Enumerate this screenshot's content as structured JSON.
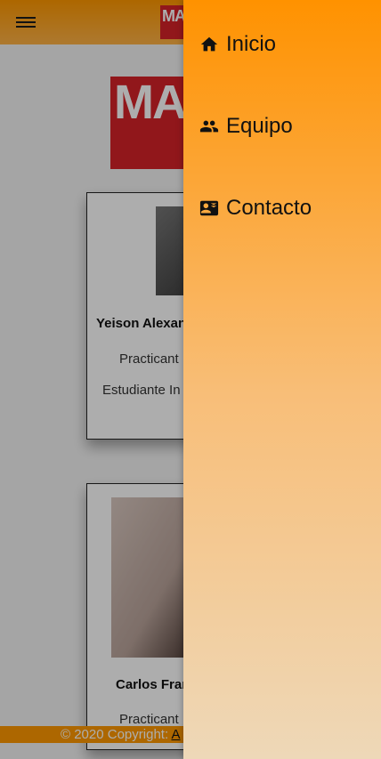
{
  "header": {
    "menu_icon": "hamburger-menu-icon",
    "logo_text": "MA TE"
  },
  "hero": {
    "logo_text": "MA TE"
  },
  "cards": [
    {
      "name": "Yeison Alexan",
      "role": "Practicant",
      "description": "Estudiante In U"
    },
    {
      "name": "Carlos Fran",
      "role": "Practicant"
    }
  ],
  "footer": {
    "copyright": "© 2020 Copyright: ",
    "link_text": "A"
  },
  "drawer": {
    "items": [
      {
        "label": "Inicio",
        "icon": "home-icon"
      },
      {
        "label": "Equipo",
        "icon": "people-icon"
      },
      {
        "label": "Contacto",
        "icon": "contact-card-icon"
      }
    ]
  },
  "colors": {
    "accent": "#ff9800",
    "logo_red": "#d62328",
    "drawer_bottom": "#eed8b8"
  }
}
